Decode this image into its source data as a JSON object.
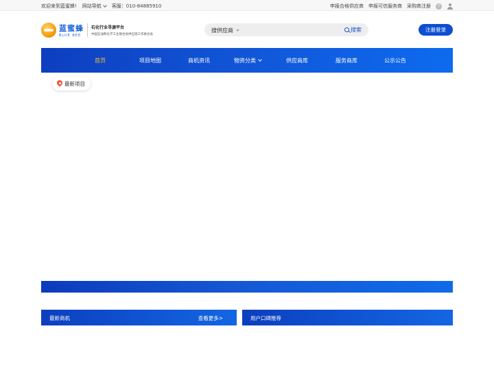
{
  "topbar": {
    "welcome": "欢迎来到蓝蜜蜂!",
    "site_nav": "网站导航",
    "service": "客服：010-84885910",
    "links": [
      "申报合格供应商",
      "申报可信服务商",
      "采购商注册"
    ]
  },
  "logo": {
    "name_cn": "蓝蜜蜂",
    "name_en": "BLUE BEE",
    "title": "石化行业寻源平台",
    "subtitle": "中国石油和化学工业联合会供应链工作委员会"
  },
  "search": {
    "category": "搜供应商",
    "button": "搜索"
  },
  "header": {
    "register_login": "注册登录"
  },
  "nav": {
    "items": [
      {
        "label": "首页"
      },
      {
        "label": "项目地图"
      },
      {
        "label": "商机资讯"
      },
      {
        "label": "物资分类"
      },
      {
        "label": "供应商库"
      },
      {
        "label": "服务商库"
      },
      {
        "label": "公示公告"
      }
    ]
  },
  "tabs": {
    "latest_projects": "最新项目"
  },
  "sections": {
    "latest_opportunities": {
      "title": "最新商机",
      "more": "查看更多>"
    },
    "user_recommend": {
      "title": "用户口碑推荐"
    }
  },
  "colors": {
    "brand_blue": "#1156d8",
    "nav_active": "#f3c13a",
    "button_blue": "#0c4fd1"
  },
  "icons": {
    "help": "question-icon",
    "user": "user-icon",
    "pin": "location-pin-icon"
  }
}
